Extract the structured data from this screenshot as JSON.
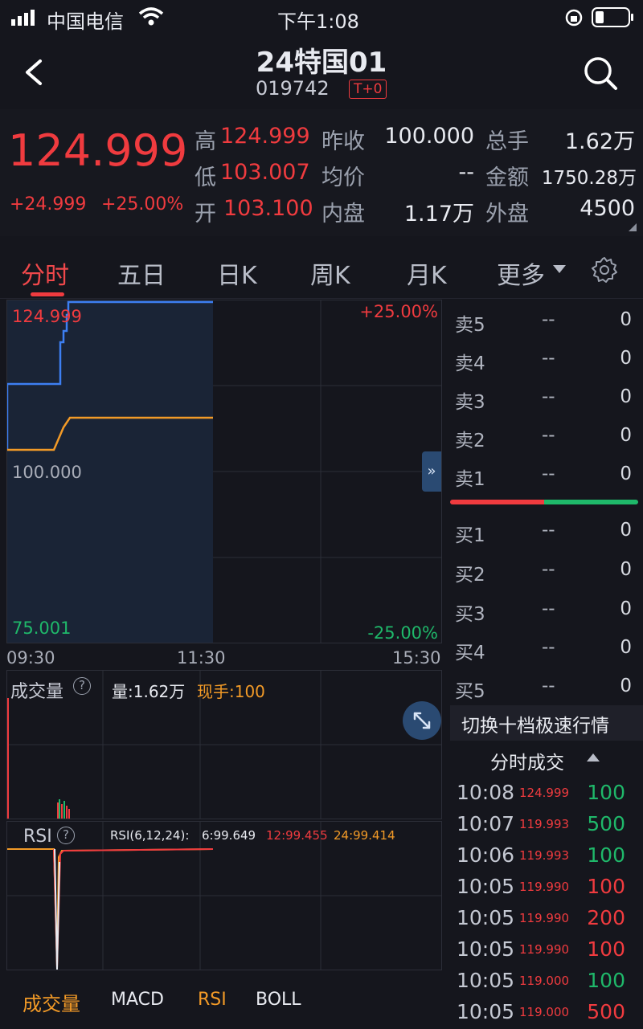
{
  "status_bar": {
    "carrier": "中国电信",
    "time": "下午1:08"
  },
  "nav": {
    "title": "24特国01",
    "code": "019742",
    "badge": "T+0"
  },
  "quote": {
    "price": "124.999",
    "change": "+24.999",
    "change_pct": "+25.00%",
    "high_label": "高",
    "high": "124.999",
    "low_label": "低",
    "low": "103.007",
    "open_label": "开",
    "open": "103.100",
    "prev_close_label": "昨收",
    "prev_close": "100.000",
    "avg_label": "均价",
    "avg": "--",
    "inner_label": "内盘",
    "inner": "1.17万",
    "total_label": "总手",
    "total": "1.62万",
    "amount_label": "金额",
    "amount": "1750.28万",
    "outer_label": "外盘",
    "outer": "4500"
  },
  "tabs": [
    "分时",
    "五日",
    "日K",
    "周K",
    "月K",
    "更多"
  ],
  "chart": {
    "price_top": "124.999",
    "price_mid": "100.000",
    "price_bottom": "75.001",
    "pct_top": "+25.00%",
    "pct_bottom": "-25.00%",
    "times": [
      "09:30",
      "11:30",
      "15:30"
    ]
  },
  "volume_panel": {
    "title": "成交量",
    "volume": "量:1.62万",
    "current": "现手:100"
  },
  "rsi_panel": {
    "title": "RSI",
    "params": "RSI(6,12,24):",
    "rsi6": "6:99.649",
    "rsi12": "12:99.455",
    "rsi24": "24:99.414"
  },
  "bottom_tabs": [
    "成交量",
    "MACD",
    "RSI",
    "BOLL"
  ],
  "order_book": {
    "asks": [
      {
        "label": "卖5",
        "price": "--",
        "vol": "0"
      },
      {
        "label": "卖4",
        "price": "--",
        "vol": "0"
      },
      {
        "label": "卖3",
        "price": "--",
        "vol": "0"
      },
      {
        "label": "卖2",
        "price": "--",
        "vol": "0"
      },
      {
        "label": "卖1",
        "price": "--",
        "vol": "0"
      }
    ],
    "bids": [
      {
        "label": "买1",
        "price": "--",
        "vol": "0"
      },
      {
        "label": "买2",
        "price": "--",
        "vol": "0"
      },
      {
        "label": "买3",
        "price": "--",
        "vol": "0"
      },
      {
        "label": "买4",
        "price": "--",
        "vol": "0"
      },
      {
        "label": "买5",
        "price": "--",
        "vol": "0"
      }
    ],
    "switch_label": "切换十档极速行情"
  },
  "trades": {
    "title": "分时成交",
    "rows": [
      {
        "time": "10:08",
        "price": "124.999",
        "vol": "100",
        "dir": "green"
      },
      {
        "time": "10:07",
        "price": "119.993",
        "vol": "500",
        "dir": "green"
      },
      {
        "time": "10:06",
        "price": "119.993",
        "vol": "100",
        "dir": "green"
      },
      {
        "time": "10:05",
        "price": "119.990",
        "vol": "100",
        "dir": "red"
      },
      {
        "time": "10:05",
        "price": "119.990",
        "vol": "200",
        "dir": "red"
      },
      {
        "time": "10:05",
        "price": "119.990",
        "vol": "100",
        "dir": "red"
      },
      {
        "time": "10:05",
        "price": "119.000",
        "vol": "100",
        "dir": "green"
      },
      {
        "time": "10:05",
        "price": "119.000",
        "vol": "500",
        "dir": "red"
      }
    ]
  },
  "colors": {
    "up": "#f03b3f",
    "down": "#1fb86a",
    "price_line": "#3d7ff2",
    "avg_line": "#f29a27"
  }
}
